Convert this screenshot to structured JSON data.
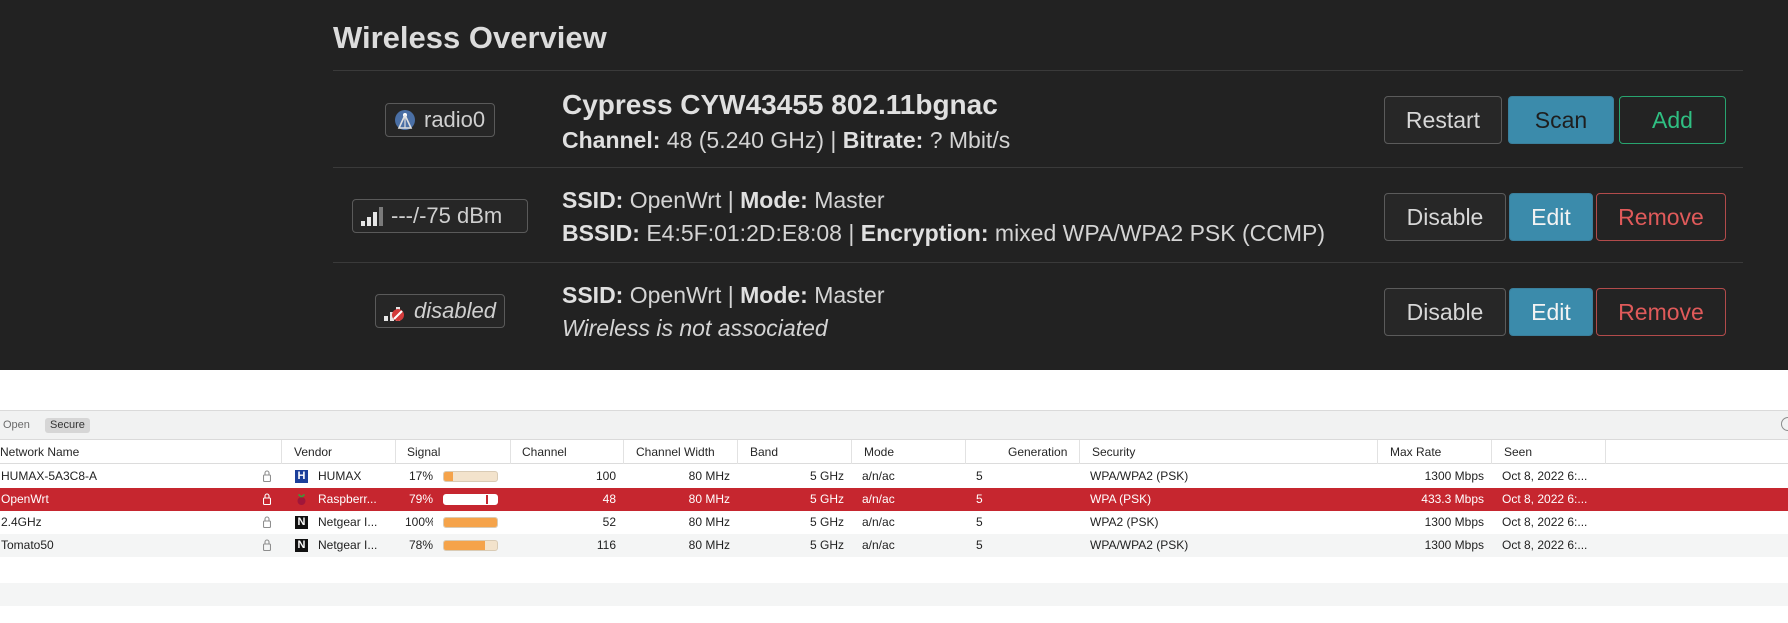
{
  "overview": {
    "title": "Wireless Overview",
    "device": {
      "badge": "radio0",
      "name": "Cypress CYW43455 802.11bgnac",
      "channel_label": "Channel:",
      "channel_value": "48 (5.240 GHz) |",
      "bitrate_label": "Bitrate:",
      "bitrate_value": "? Mbit/s",
      "buttons": {
        "restart": "Restart",
        "scan": "Scan",
        "add": "Add"
      }
    },
    "networks": [
      {
        "badge": "---/-75 dBm",
        "ssid_label": "SSID:",
        "ssid_value": "OpenWrt |",
        "mode_label": "Mode:",
        "mode_value": "Master",
        "bssid_label": "BSSID:",
        "bssid_value": "E4:5F:01:2D:E8:08 |",
        "enc_label": "Encryption:",
        "enc_value": "mixed WPA/WPA2 PSK (CCMP)",
        "buttons": {
          "disable": "Disable",
          "edit": "Edit",
          "remove": "Remove"
        }
      },
      {
        "badge": "disabled",
        "ssid_label": "SSID:",
        "ssid_value": "OpenWrt |",
        "mode_label": "Mode:",
        "mode_value": "Master",
        "status": "Wireless is not associated",
        "buttons": {
          "disable": "Disable",
          "edit": "Edit",
          "remove": "Remove"
        }
      }
    ]
  },
  "scanner": {
    "filters": {
      "open": "Open",
      "secure": "Secure"
    },
    "columns": [
      "Network Name",
      "Vendor",
      "Signal",
      "Channel",
      "Channel Width",
      "Band",
      "Mode",
      "Generation",
      "Security",
      "Max Rate",
      "Seen"
    ],
    "rows": [
      {
        "name": "HUMAX-5A3C8-A",
        "vendor": "HUMAX",
        "vendor_icon": "H",
        "signal": "17%",
        "signal_level": 0.17,
        "channel": "100",
        "width": "80 MHz",
        "band": "5 GHz",
        "mode": "a/n/ac",
        "generation": "5",
        "security": "WPA/WPA2 (PSK)",
        "max_rate": "1300 Mbps",
        "seen": "Oct 8, 2022 6:..."
      },
      {
        "name": "OpenWrt",
        "vendor": "Raspberr...",
        "vendor_icon": "raspberry",
        "signal": "79%",
        "signal_level": 0.79,
        "channel": "48",
        "width": "80 MHz",
        "band": "5 GHz",
        "mode": "a/n/ac",
        "generation": "5",
        "security": "WPA (PSK)",
        "max_rate": "433.3 Mbps",
        "seen": "Oct 8, 2022 6:..."
      },
      {
        "name": "2.4GHz",
        "vendor": "Netgear I...",
        "vendor_icon": "N",
        "signal": "100%",
        "signal_level": 1.0,
        "channel": "52",
        "width": "80 MHz",
        "band": "5 GHz",
        "mode": "a/n/ac",
        "generation": "5",
        "security": "WPA2 (PSK)",
        "max_rate": "1300 Mbps",
        "seen": "Oct 8, 2022 6:..."
      },
      {
        "name": "Tomato50",
        "vendor": "Netgear I...",
        "vendor_icon": "N",
        "signal": "78%",
        "signal_level": 0.78,
        "channel": "116",
        "width": "80 MHz",
        "band": "5 GHz",
        "mode": "a/n/ac",
        "generation": "5",
        "security": "WPA/WPA2 (PSK)",
        "max_rate": "1300 Mbps",
        "seen": "Oct 8, 2022 6:..."
      }
    ],
    "selected_row": 1
  }
}
